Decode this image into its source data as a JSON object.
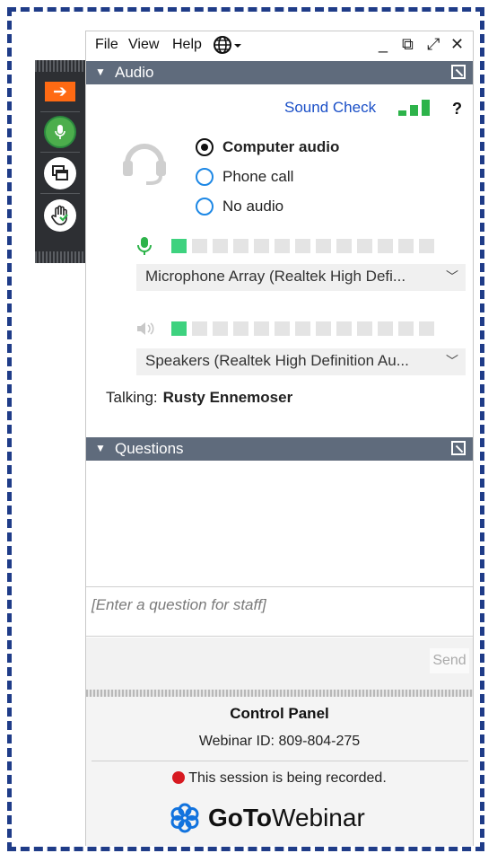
{
  "menu": {
    "file": "File",
    "view": "View",
    "help": "Help"
  },
  "window_controls": {
    "minimize": "_",
    "dock": "⧉",
    "popout": "⤢",
    "close": "✕"
  },
  "audio_section": {
    "title": "Audio"
  },
  "sound_check": {
    "label": "Sound Check",
    "help": "?"
  },
  "audio_options": [
    {
      "label": "Computer audio",
      "selected": true
    },
    {
      "label": "Phone call",
      "selected": false
    },
    {
      "label": "No audio",
      "selected": false
    }
  ],
  "microphone": {
    "device": "Microphone Array (Realtek High Defi...",
    "level_segments": 13,
    "level_active": 1
  },
  "speakers": {
    "device": "Speakers (Realtek High Definition Au...",
    "level_segments": 13,
    "level_active": 1
  },
  "talking": {
    "label": "Talking:",
    "name": "Rusty Ennemoser"
  },
  "questions_section": {
    "title": "Questions",
    "placeholder": "[Enter a question for staff]",
    "send_label": "Send"
  },
  "footer": {
    "title": "Control Panel",
    "webinar_id": "Webinar ID: 809-804-275",
    "recording": "This session is being recorded.",
    "logo_goto": "GoTo",
    "logo_webinar": "Webinar"
  },
  "colors": {
    "accent_orange": "#ff6a13",
    "mic_green": "#4cae4c",
    "level_green": "#3ed27f",
    "link_blue": "#1a4fc7",
    "section_header": "#5f6b7c",
    "recording_red": "#d71920",
    "border_dash": "#1f3c88"
  }
}
